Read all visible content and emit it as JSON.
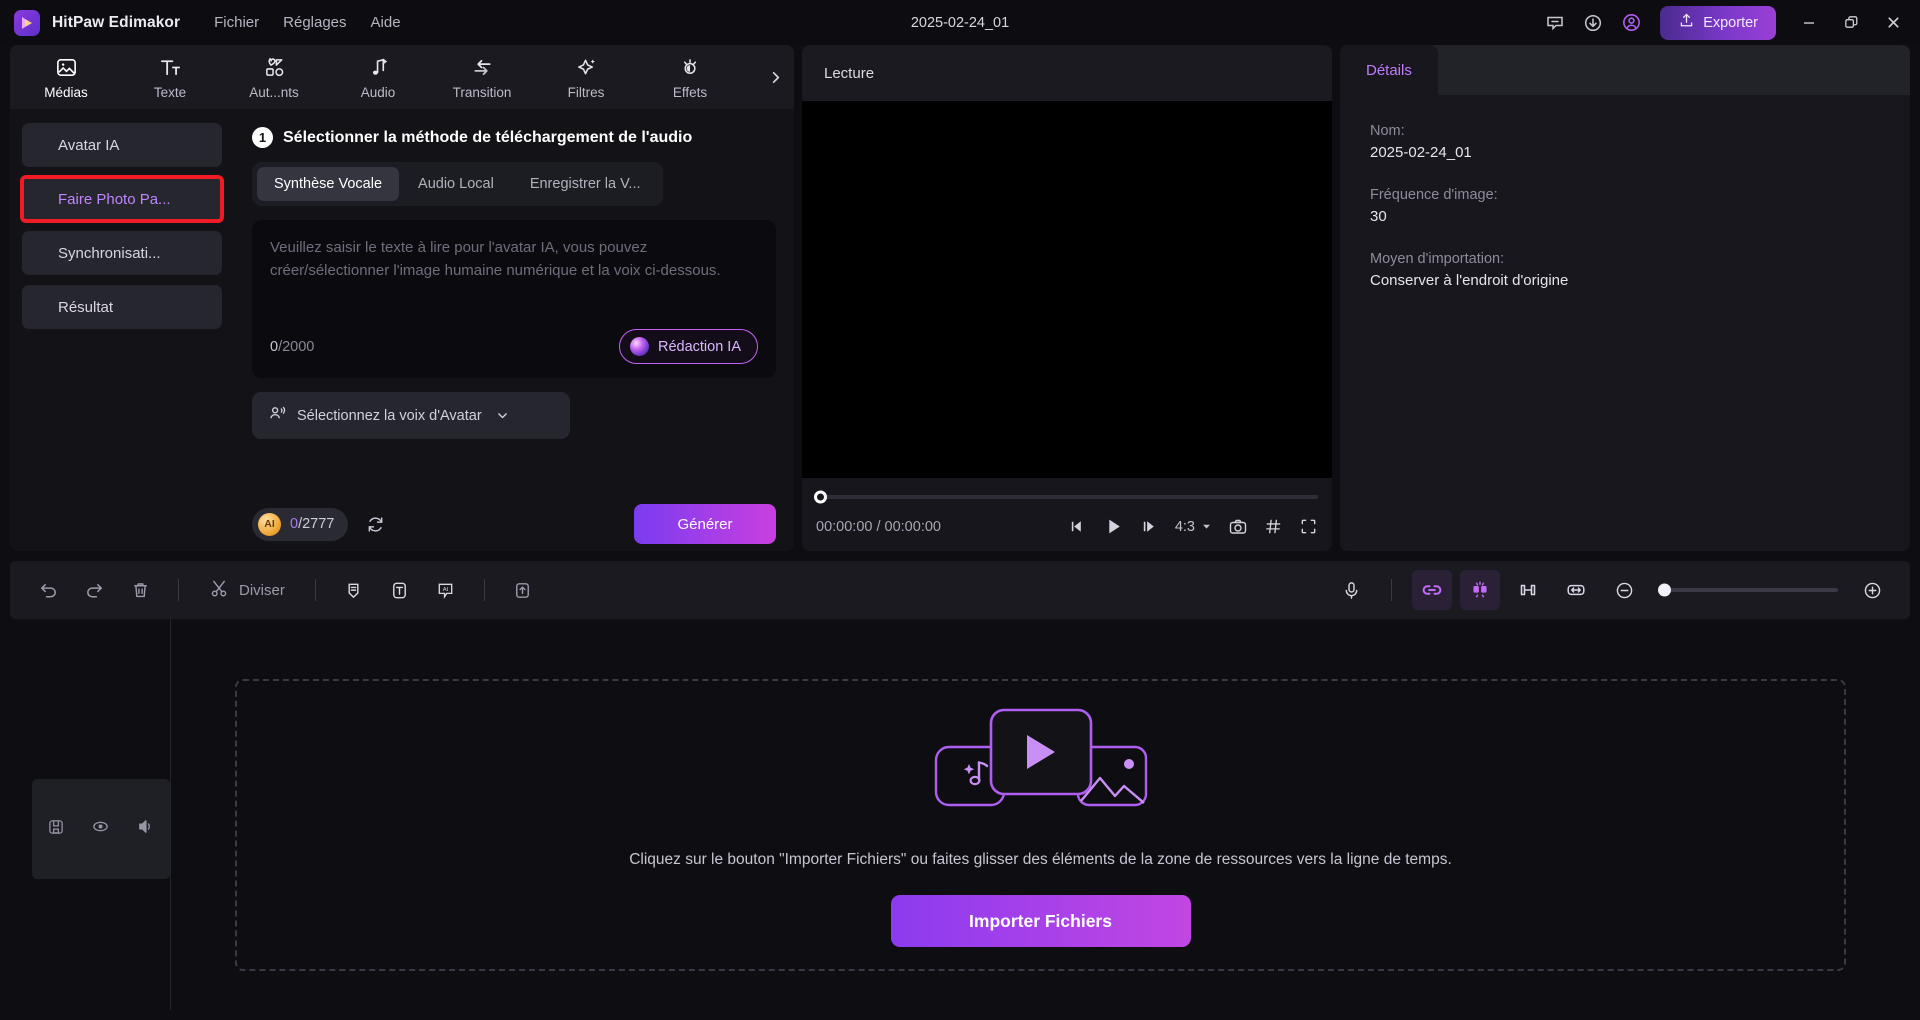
{
  "titlebar": {
    "app_title": "HitPaw Edimakor",
    "menus": [
      "Fichier",
      "Réglages",
      "Aide"
    ],
    "document_name": "2025-02-24_01",
    "export_label": "Exporter",
    "icons": [
      "feedback-icon",
      "download-icon",
      "account-icon"
    ],
    "accent": "#9a3fd6"
  },
  "toolbar_tabs": [
    {
      "label": "Médias",
      "icon": "media-icon"
    },
    {
      "label": "Texte",
      "icon": "text-icon"
    },
    {
      "label": "Aut...nts",
      "icon": "elements-icon"
    },
    {
      "label": "Audio",
      "icon": "audio-icon"
    },
    {
      "label": "Transition",
      "icon": "transition-icon"
    },
    {
      "label": "Filtres",
      "icon": "filters-icon"
    },
    {
      "label": "Effets",
      "icon": "effects-icon"
    }
  ],
  "sidebar": {
    "items": [
      {
        "label": "Avatar IA",
        "highlighted": false
      },
      {
        "label": "Faire Photo Pa...",
        "highlighted": true
      },
      {
        "label": "Synchronisati...",
        "highlighted": false
      },
      {
        "label": "Résultat",
        "highlighted": false
      }
    ],
    "highlight_color": "#f01b24",
    "highlight_text_color": "#c084fc"
  },
  "center": {
    "step_number": "1",
    "step_title": "Sélectionner la méthode de téléchargement de l'audio",
    "segments": [
      {
        "label": "Synthèse Vocale",
        "active": true
      },
      {
        "label": "Audio Local",
        "active": false
      },
      {
        "label": "Enregistrer la V...",
        "active": false
      }
    ],
    "textarea_placeholder": "Veuillez saisir le texte à lire pour l'avatar IA, vous pouvez créer/sélectionner l'image humaine numérique et la voix ci-dessous.",
    "char_count": "0",
    "char_max": "/2000",
    "ai_write_label": "Rédaction IA",
    "voice_select_label": "Sélectionnez la voix d'Avatar",
    "credits_count": "0",
    "credits_max": "/2777",
    "generate_label": "Générer"
  },
  "preview": {
    "title": "Lecture",
    "current_time": "00:00:00",
    "total_time": "00:00:00",
    "time_display": "00:00:00 / 00:00:00",
    "aspect_ratio": "4:3",
    "controls": [
      "prev-frame-icon",
      "play-icon",
      "next-frame-icon",
      "snapshot-icon",
      "grid-icon",
      "fullscreen-icon"
    ]
  },
  "details": {
    "tab_label": "Détails",
    "fields": [
      {
        "label": "Nom:",
        "value": "2025-02-24_01"
      },
      {
        "label": "Fréquence d'image:",
        "value": "30"
      },
      {
        "label": "Moyen d'importation:",
        "value": "Conserver à l'endroit d'origine"
      }
    ]
  },
  "timeline_toolbar": {
    "split_label": "Diviser",
    "left_icons": [
      "undo-icon",
      "redo-icon",
      "delete-icon",
      "scissors-icon",
      "marker-icon",
      "text-box-icon",
      "ai-caption-icon",
      "export-clip-icon"
    ],
    "right_icons": [
      "microphone-icon",
      "link-clips-icon",
      "magnet-icon",
      "crop-icon",
      "fit-icon",
      "zoom-out-icon",
      "zoom-in-icon"
    ]
  },
  "timeline": {
    "track_head_icons": [
      "lock-icon",
      "eye-icon",
      "speaker-icon"
    ],
    "drop_hint": "Cliquez sur le bouton \"Importer Fichiers\" ou faites glisser des éléments de la zone de ressources vers la ligne de temps.",
    "import_label": "Importer Fichiers"
  }
}
